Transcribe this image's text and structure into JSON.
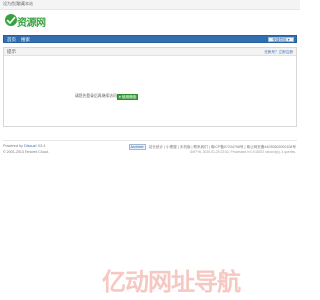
{
  "topbar": {
    "link_1": "设为首页",
    "link_2": "收藏本站"
  },
  "logo": {
    "text": "资源网"
  },
  "nav": {
    "items": [
      "首页",
      "搜索"
    ],
    "quick_button": "快捷导航 ▾"
  },
  "panel": {
    "title": "提示",
    "right": "无帐号？立即注册"
  },
  "login": {
    "message": "请您先登录后再继续访问",
    "button": "使用微信登录"
  },
  "footer": {
    "powered_by": "Powered by",
    "brand": "Discuz!",
    "version": "X3.4",
    "copyright": "© 2001-2013 Tencent Cloud.",
    "right_links": "站长统计 | 小黑屋 | 手机版 | 联系我们 | 粤ICP备07234798号 | 粤公网安备44030502000108号",
    "right_badge": "Archiver",
    "right_meta": "GMT+8, 2025-01-25 22:52, Processed in 0.016337 second(s), 4 queries."
  },
  "watermark": {
    "text": "亿动网址导航"
  },
  "colors": {
    "nav_blue": "#2f6fb2",
    "logo_green": "#37a33f",
    "button_green": "#3fa640"
  }
}
